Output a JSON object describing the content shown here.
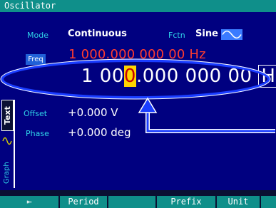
{
  "window": {
    "title": "Oscillator"
  },
  "params": {
    "mode_label": "Mode",
    "mode_value": "Continuous",
    "fctn_label": "Fctn",
    "fctn_value": "Sine",
    "freq_label": "Freq",
    "freq_small_value": "1 000.000 000 00 Hz",
    "offset_label": "Offset",
    "offset_value": "+0.000 V",
    "phase_label": "Phase",
    "phase_value": "+0.000 deg"
  },
  "zoom": {
    "integer_before_cursor": "1 00",
    "cursor_digit": "0",
    "fraction": ".000 000 00 ",
    "unit": "Hz"
  },
  "side_tabs": {
    "text_tab": "Text",
    "graph_tab": "Graph"
  },
  "softkeys": {
    "back_icon_glyph": "⇤",
    "period_label": "Period",
    "prefix_label": "Prefix",
    "unit_label": "Unit"
  },
  "colors": {
    "panel": "#000080",
    "header": "#0f8f8a",
    "accent_red": "#ff3b2f",
    "cursor_bg": "#ffd500",
    "annotation_blue": "#1a3dff"
  }
}
